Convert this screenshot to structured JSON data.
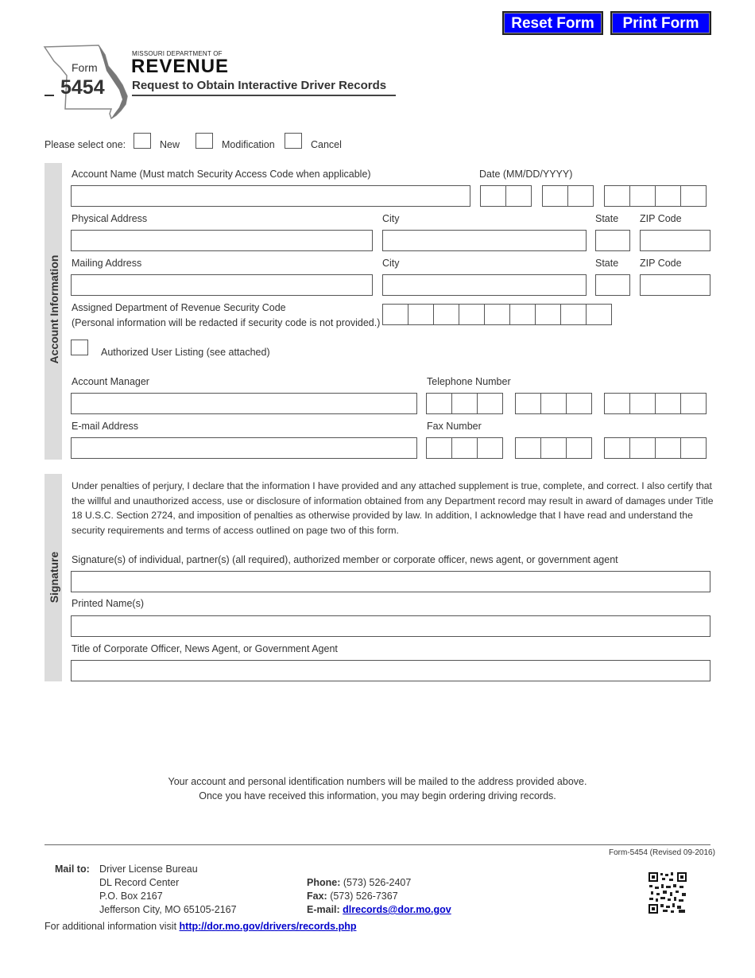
{
  "toolbar": {
    "reset_label": "Reset Form",
    "print_label": "Print Form"
  },
  "header": {
    "form_word": "Form",
    "form_number": "5454",
    "dept_line": "MISSOURI DEPARTMENT OF",
    "dept_name": "REVENUE",
    "title": "Request to Obtain Interactive Driver Records"
  },
  "selection": {
    "prompt": "Please select one:",
    "options": [
      "New",
      "Modification",
      "Cancel"
    ]
  },
  "account_section": {
    "title": "Account Information",
    "account_name_label": "Account Name (Must match Security Access Code when applicable)",
    "date_label": "Date (MM/DD/YYYY)",
    "physical_address_label": "Physical Address",
    "city_label": "City",
    "state_label": "State",
    "zip_label": "ZIP Code",
    "mailing_address_label": "Mailing Address",
    "security_code_label": "Assigned Department of Revenue Security Code",
    "security_code_note": "(Personal information will be redacted if security code is not provided.)",
    "authorized_user_label": "Authorized User Listing (see attached)",
    "account_manager_label": "Account Manager",
    "telephone_label": "Telephone Number",
    "email_label": "E-mail Address",
    "fax_label": "Fax Number"
  },
  "signature_section": {
    "title": "Signature",
    "declaration": "Under penalties of perjury, I declare that the information I have provided and any attached supplement is true, complete, and correct. I also certify that the willful and unauthorized access, use or disclosure of information obtained from any Department record may result in award of damages under Title 18 U.S.C. Section 2724, and imposition of penalties as otherwise provided by law.  In addition, I acknowledge that I have read and understand the security requirements and terms of access outlined on page two of this form.",
    "signature_label": "Signature(s) of individual, partner(s) (all required), authorized member or corporate officer, news agent, or government agent",
    "printed_name_label": "Printed Name(s)",
    "title_label": "Title of Corporate Officer, News Agent, or Government Agent"
  },
  "notice": {
    "line1": "Your account and personal identification numbers will be mailed to the address provided above.",
    "line2": "Once you have received this information, you may begin ordering driving records."
  },
  "footer": {
    "revision": "Form-5454 (Revised 09-2016)",
    "mail_to_label": "Mail to:",
    "address_lines": [
      "Driver License Bureau",
      "DL Record Center",
      "P.O. Box 2167",
      "Jefferson City, MO 65105-2167"
    ],
    "phone_label": "Phone:",
    "phone": "(573) 526-2407",
    "fax_label": "Fax:",
    "fax": "(573) 526-7367",
    "email_label": "E-mail:",
    "email": "dlrecords@dor.mo.gov",
    "info_text": "For additional information visit",
    "info_url": "http://dor.mo.gov/drivers/records.php"
  }
}
